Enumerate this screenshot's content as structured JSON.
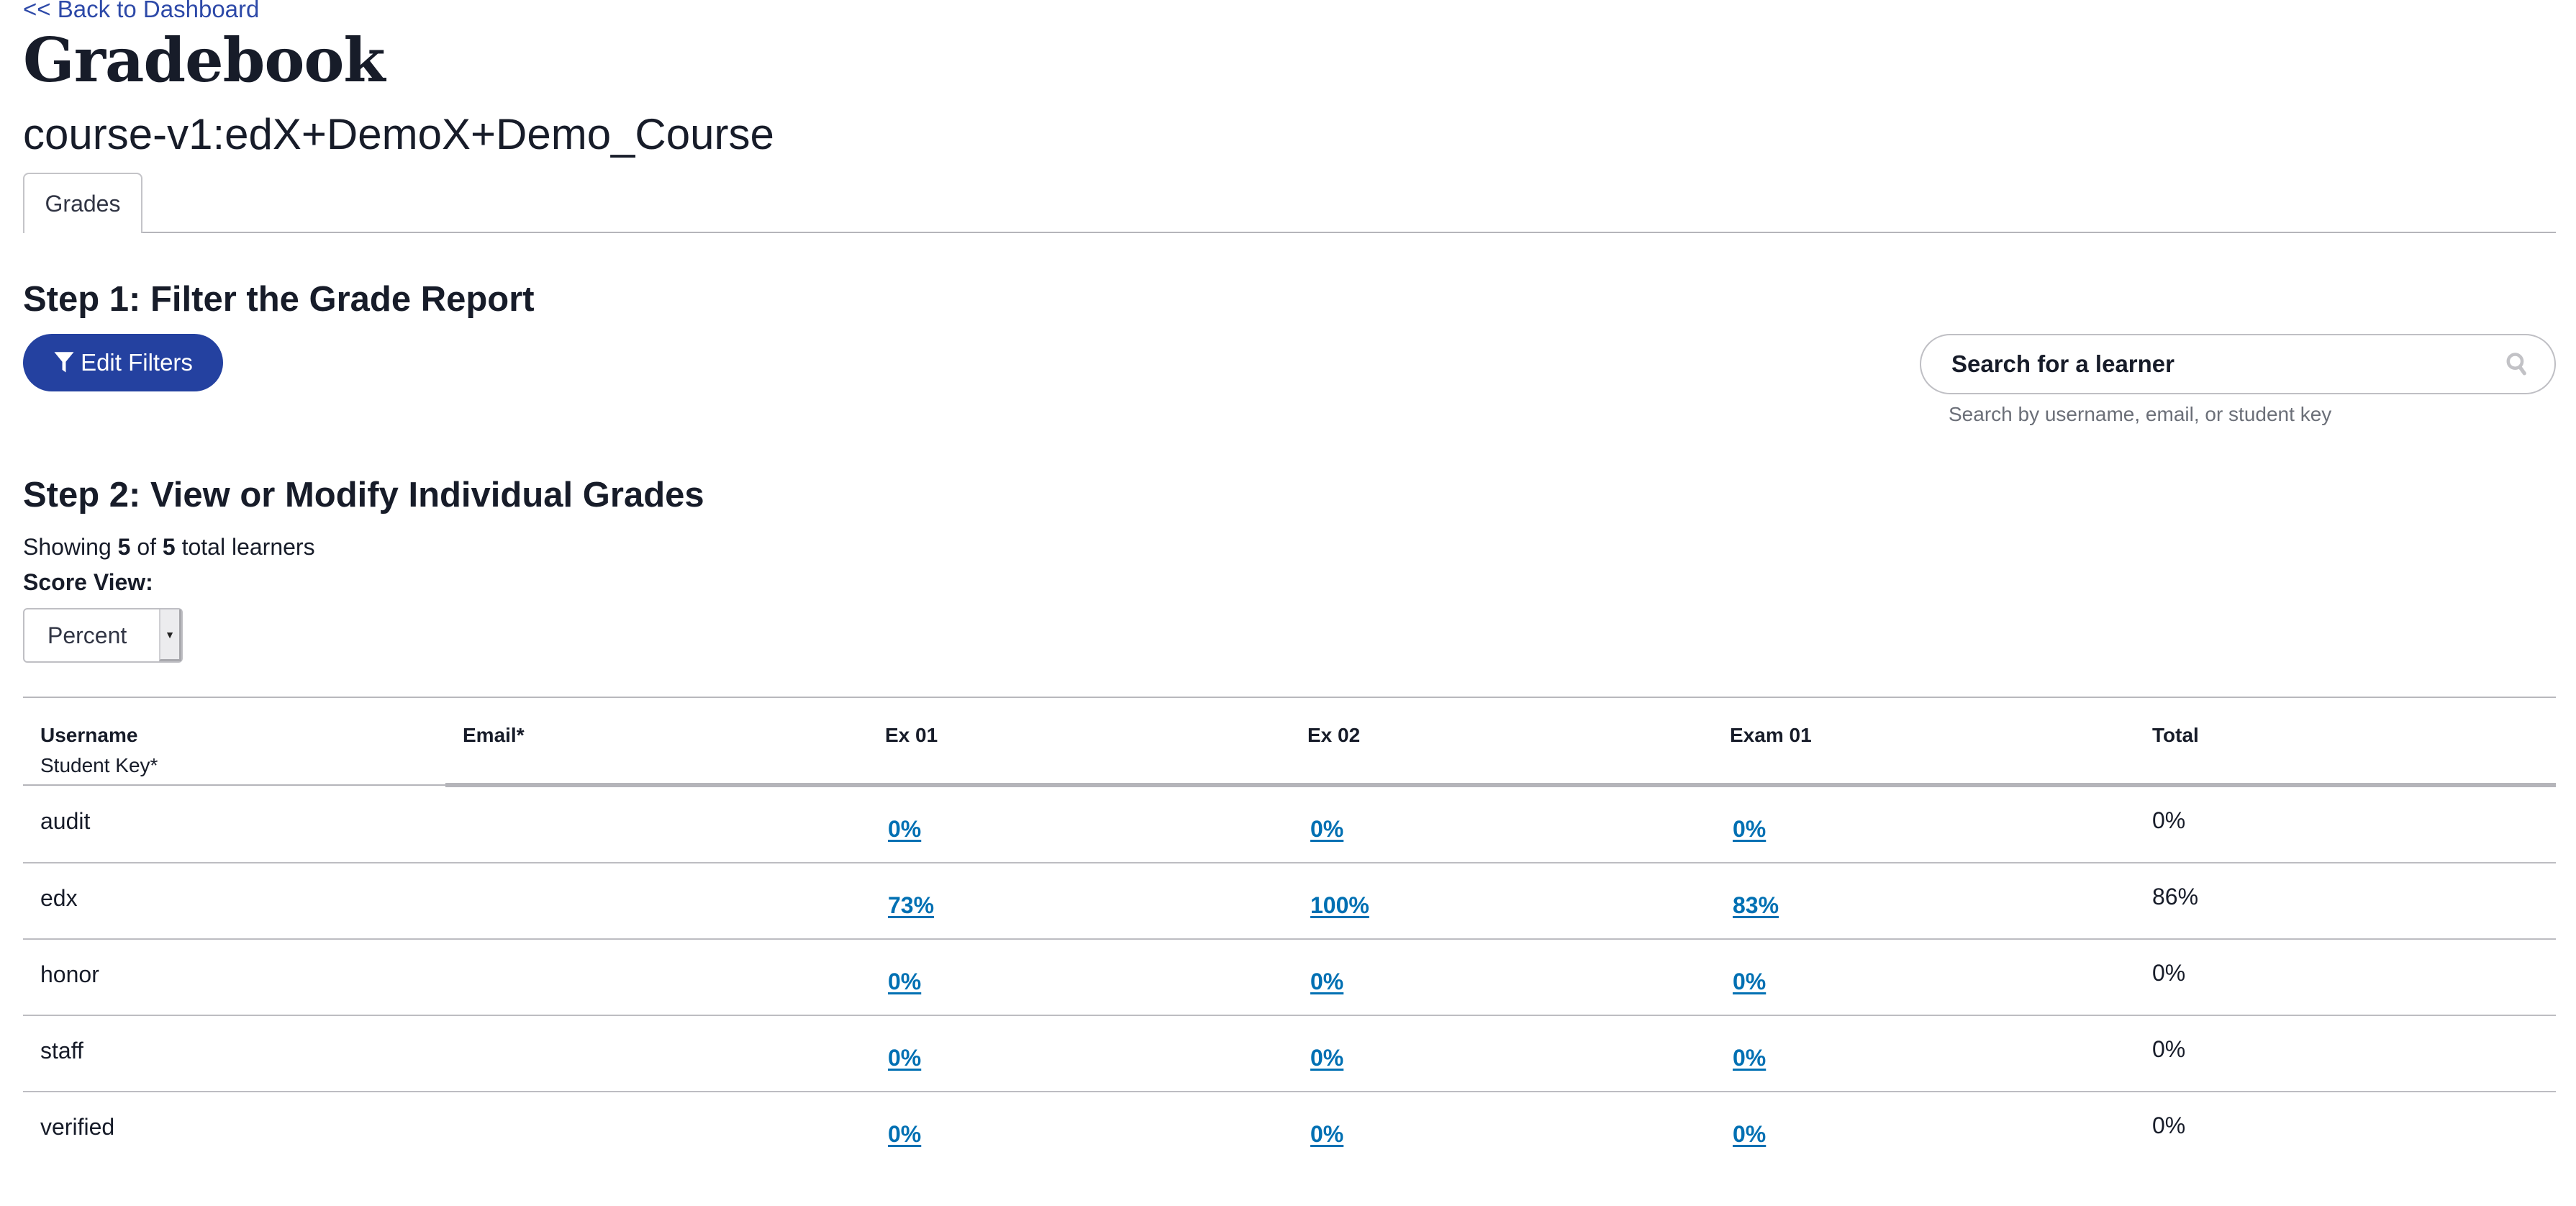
{
  "nav": {
    "back_label": "<< Back to Dashboard"
  },
  "header": {
    "title": "Gradebook",
    "course_id": "course-v1:edX+DemoX+Demo_Course"
  },
  "tabs": [
    {
      "label": "Grades",
      "active": true
    }
  ],
  "step1": {
    "heading": "Step 1: Filter the Grade Report",
    "edit_filters_label": "Edit Filters",
    "edit_filters_icon": "filter-icon",
    "search": {
      "placeholder": "Search for a learner",
      "value": "",
      "icon": "search-icon",
      "help_text": "Search by username, email, or student key"
    }
  },
  "step2": {
    "heading": "Step 2: View or Modify Individual Grades",
    "showing_prefix": "Showing",
    "showing_count": "5",
    "showing_of": "of",
    "total_count": "5",
    "showing_suffix": "total learners",
    "score_view_label": "Score View:",
    "score_view_value": "Percent"
  },
  "table": {
    "columns": [
      {
        "label": "Username",
        "sublabel": "Student Key*"
      },
      {
        "label": "Email*"
      },
      {
        "label": "Ex 01"
      },
      {
        "label": "Ex 02"
      },
      {
        "label": "Exam 01"
      },
      {
        "label": "Total"
      }
    ],
    "rows": [
      {
        "username": "audit",
        "email": "",
        "ex01": "0%",
        "ex02": "0%",
        "exam01": "0%",
        "total": "0%"
      },
      {
        "username": "edx",
        "email": "",
        "ex01": "73%",
        "ex02": "100%",
        "exam01": "83%",
        "total": "86%"
      },
      {
        "username": "honor",
        "email": "",
        "ex01": "0%",
        "ex02": "0%",
        "exam01": "0%",
        "total": "0%"
      },
      {
        "username": "staff",
        "email": "",
        "ex01": "0%",
        "ex02": "0%",
        "exam01": "0%",
        "total": "0%"
      },
      {
        "username": "verified",
        "email": "",
        "ex01": "0%",
        "ex02": "0%",
        "exam01": "0%",
        "total": "0%"
      }
    ]
  },
  "colors": {
    "brand_primary": "#2441a0",
    "link": "#2d49a8",
    "grade_link": "#0070b3",
    "text": "#171c29"
  }
}
